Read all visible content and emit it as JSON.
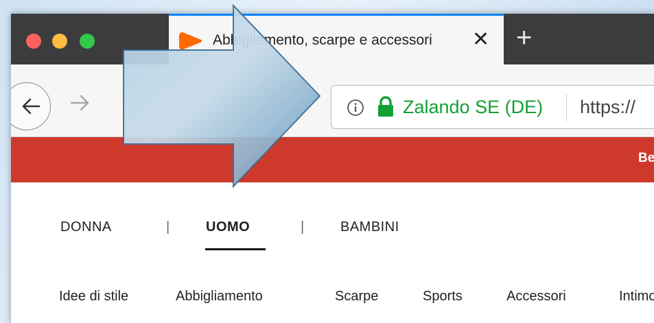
{
  "browser": {
    "tab_title": "Abbigliamento, scarpe e accessori",
    "tab_close": "✕",
    "new_tab": "+",
    "identity_label": "Zalando SE (DE)",
    "url": "https://"
  },
  "banner": {
    "text": "Benvenuto"
  },
  "gender_nav": {
    "items": [
      "DONNA",
      "UOMO",
      "BAMBINI"
    ],
    "separator": "|",
    "active": "UOMO"
  },
  "category_nav": {
    "items": [
      "Idee di stile",
      "Abbigliamento",
      "Scarpe",
      "Sports",
      "Accessori",
      "Intimo"
    ]
  },
  "colors": {
    "banner_red": "#cd3a2c",
    "secure_green": "#12a034",
    "titlebar": "#3c3c3f",
    "arrow_fill": "#8fb6d3"
  },
  "icons": [
    "back-arrow-icon",
    "forward-arrow-icon",
    "info-icon",
    "lock-icon",
    "zalando-logo-icon",
    "close-icon",
    "plus-icon",
    "pointer-arrow-icon"
  ]
}
